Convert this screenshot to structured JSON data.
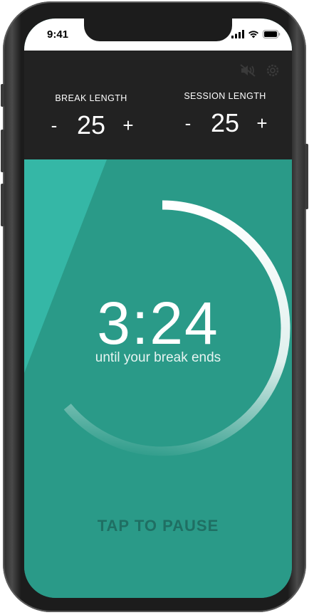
{
  "status_bar": {
    "time": "9:41"
  },
  "header": {
    "icons": [
      "mute-icon",
      "settings-icon"
    ],
    "break": {
      "label": "BREAK LENGTH",
      "decrement": "-",
      "value": "25",
      "increment": "+"
    },
    "session": {
      "label": "SESSION LENGTH",
      "decrement": "-",
      "value": "25",
      "increment": "+"
    }
  },
  "timer": {
    "clock": "3:24",
    "subtitle": "until your break ends",
    "progress": 0.64,
    "action_label": "TAP TO PAUSE"
  },
  "colors": {
    "header_bg": "#222222",
    "main_bg": "#2a9a88",
    "accent_light": "#35b7a6",
    "action_text": "#1f6f63"
  }
}
